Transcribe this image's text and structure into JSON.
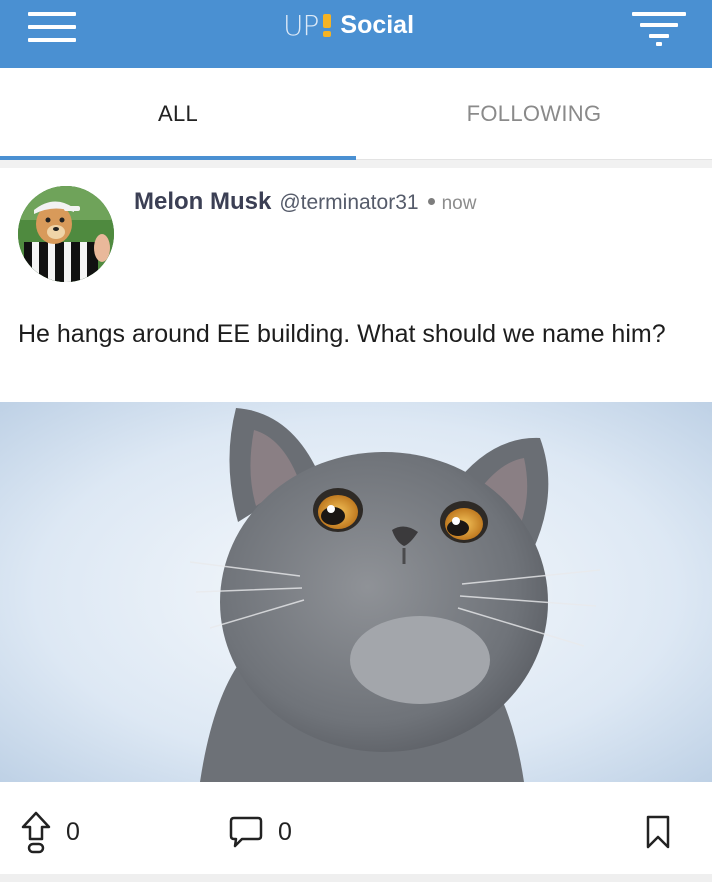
{
  "header": {
    "brand_prefix": "UP",
    "brand_name": "Social",
    "menu_icon": "hamburger-menu-icon",
    "filter_icon": "filter-icon",
    "color": "#4a90d2",
    "accent": "#f5b324"
  },
  "tabs": [
    {
      "label": "ALL",
      "active": true
    },
    {
      "label": "FOLLOWING",
      "active": false
    }
  ],
  "post": {
    "author_name": "Melon Musk",
    "author_handle": "@terminator31",
    "time": "now",
    "text": "He hangs around EE building. What should we name him?",
    "image_subject": "gray cat looking up",
    "upvotes": "0",
    "comments": "0",
    "icons": {
      "upvote": "upvote-arrow-icon",
      "comment": "comment-bubble-icon",
      "bookmark": "bookmark-icon"
    }
  }
}
